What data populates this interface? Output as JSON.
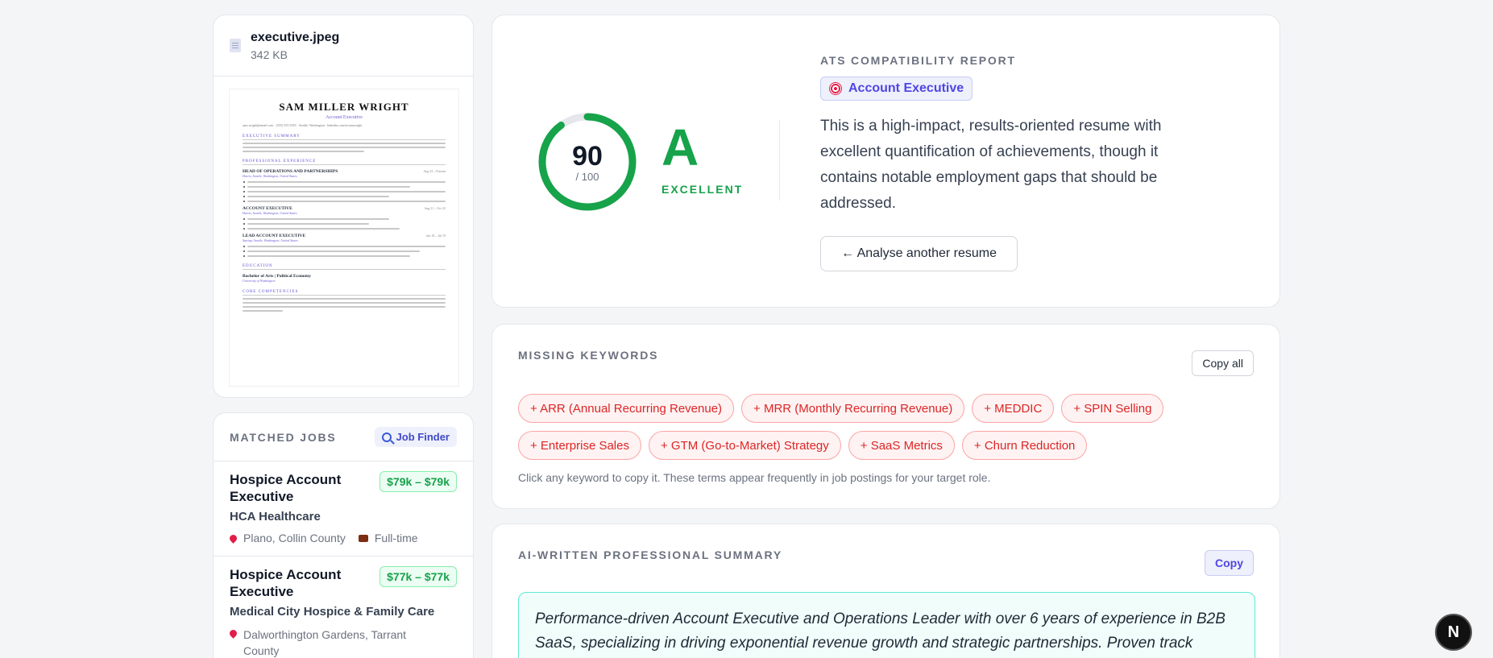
{
  "file": {
    "name": "executive.jpeg",
    "size": "342 KB"
  },
  "preview": {
    "name": "SAM MILLER WRIGHT",
    "title": "Account Executive",
    "contact": "sam.wright@email.com · (555) 555-5555 · Seattle, Washington · linkedin.com/in/samwright",
    "sections": {
      "summary": "EXECUTIVE SUMMARY",
      "experience": "PROFESSIONAL EXPERIENCE",
      "education": "EDUCATION",
      "competencies": "CORE COMPETENCIES"
    },
    "roles": [
      {
        "title": "HEAD OF OPERATIONS AND PARTNERSHIPS",
        "dates": "Aug 23 – Present",
        "loc": "Harris, Seattle, Washington, United States"
      },
      {
        "title": "ACCOUNT EXECUTIVE",
        "dates": "Aug 21 – Oct 22",
        "loc": "Harris, Seattle, Washington, United States"
      },
      {
        "title": "LEAD ACCOUNT EXECUTIVE",
        "dates": "Jan 18 – Jul 19",
        "loc": "Startup, Seattle, Washington, United States"
      }
    ],
    "degree": "Bachelor of Arts | Political Economy",
    "school": "University of Washington"
  },
  "jobs": {
    "title": "MATCHED JOBS",
    "finder_label": "Job Finder",
    "items": [
      {
        "title": "Hospice Account Executive",
        "salary": "$79k – $79k",
        "company": "HCA Healthcare",
        "location": "Plano, Collin County",
        "type": "Full-time"
      },
      {
        "title": "Hospice Account Executive",
        "salary": "$77k – $77k",
        "company": "Medical City Hospice & Family Care",
        "location": "Dalworthington Gardens, Tarrant County",
        "type": ""
      }
    ]
  },
  "report": {
    "title": "ATS COMPATIBILITY REPORT",
    "role": "Account Executive",
    "score": "90",
    "score_max": "/ 100",
    "score_value": 90,
    "grade": "A",
    "grade_label": "EXCELLENT",
    "summary": "This is a high-impact, results-oriented resume with excellent quantification of achievements, though it contains notable employment gaps that should be addressed.",
    "analyse_label": "← Analyse another resume",
    "accent": "#16a34a"
  },
  "keywords": {
    "title": "MISSING KEYWORDS",
    "copy_all_label": "Copy all",
    "items": [
      "+ ARR (Annual Recurring Revenue)",
      "+ MRR (Monthly Recurring Revenue)",
      "+ MEDDIC",
      "+ SPIN Selling",
      "+ Enterprise Sales",
      "+ GTM (Go-to-Market) Strategy",
      "+ SaaS Metrics",
      "+ Churn Reduction"
    ],
    "note": "Click any keyword to copy it. These terms appear frequently in job postings for your target role."
  },
  "ai_summary": {
    "title": "AI-WRITTEN PROFESSIONAL SUMMARY",
    "copy_label": "Copy",
    "text": "Performance-driven Account Executive and Operations Leader with over 6 years of experience in B2B SaaS, specializing in driving exponential revenue growth and strategic partnerships. Proven track record"
  },
  "next_badge": "N"
}
